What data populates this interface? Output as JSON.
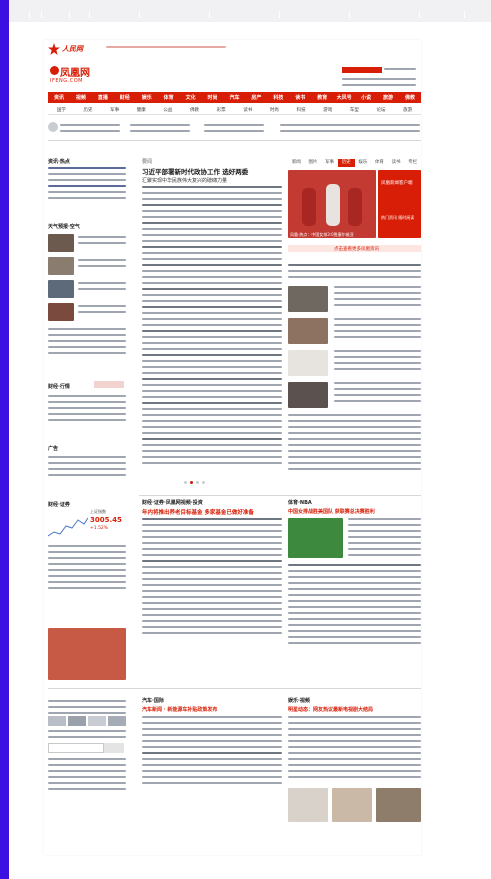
{
  "header": {
    "logo_text": "凤凰网",
    "logo_domain": "IFENG.COM",
    "top_brand": "人民网",
    "links": [
      "登录",
      "注册",
      "凤凰新闻客户端"
    ]
  },
  "nav": {
    "primary": [
      "资讯",
      "视频",
      "直播",
      "财经",
      "娱乐",
      "体育",
      "文化",
      "时尚",
      "汽车",
      "房产",
      "科技",
      "读书",
      "教育",
      "大风号",
      "小说",
      "旅游",
      "佛教",
      "FC"
    ],
    "secondary": [
      "国学",
      "历史",
      "军事",
      "健康",
      "公益",
      "佛教",
      "彩票",
      "读书",
      "时尚",
      "科技",
      "游戏",
      "车型",
      "论坛",
      "旅游",
      "汽车"
    ]
  },
  "headline": {
    "label": "要闻",
    "title": "习近平部署新时代政协工作 选好两委",
    "subtitle": "汇聚实现中华民族伟大复兴的磅礴力量"
  },
  "right_tabs": [
    "新闻",
    "图片",
    "军事",
    "历史",
    "娱乐",
    "体育",
    "读书",
    "专栏"
  ],
  "left_sections": {
    "intro": "资讯·热点",
    "weather": "天气预报·空气",
    "quote": "财经·行情",
    "ad": "广告"
  },
  "feature_photo": {
    "caption": "凤凰·热点：中国女排3:0胜塞尔维亚"
  },
  "promo": {
    "badge": "凤凰新闻客户端",
    "sub": "热门资讯 随时阅读"
  },
  "more_link": "点击查看更多凤凰资讯",
  "stock": {
    "name": "上证指数",
    "value": "3005.45",
    "change": "+1.52%"
  },
  "sections": {
    "finance": "财经·证券·凤凰网视频·投资",
    "finance_headline": "年内将推出养老目标基金 多家基金已做好准备",
    "sports": "体育·NBA",
    "sports_headline": "中国女排战胜美国队 获联赛总决赛胜利",
    "auto": "汽车·国际",
    "auto_headline": "汽车新闻 · 新能源车补贴政策发布",
    "ent": "娱乐·视频",
    "ent_headline": "明星动态：网友热议最新电视剧大结局",
    "left_bottom": "财经·证券"
  },
  "colors": {
    "brand_red": "#d81e06",
    "sidebar_blue": "#3b10e0"
  }
}
